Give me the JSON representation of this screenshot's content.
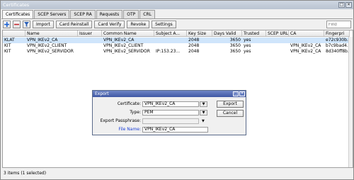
{
  "window": {
    "title": "Certificates",
    "controls": [
      "□",
      "✕"
    ]
  },
  "tabs": [
    "Certificates",
    "SCEP Servers",
    "SCEP RA",
    "Requests",
    "OTP",
    "CRL"
  ],
  "toolbar": {
    "buttons": [
      "Import",
      "Card Reinstall",
      "Card Verify",
      "Revoke",
      "Settings"
    ],
    "find_placeholder": "Find"
  },
  "table": {
    "columns": [
      "",
      "Name",
      "Issuer",
      "Common Name",
      "Subject A...",
      "Key Size",
      "Days Valid",
      "Trusted",
      "SCEP URL",
      "CA",
      "Fingerpri"
    ],
    "rows": [
      {
        "flags": "KLAT",
        "name": "VPN_IKEv2_CA",
        "issuer": "",
        "common_name": "VPN_IKEv2_CA",
        "subject_alt": "",
        "key_size": "2048",
        "days_valid": "3650",
        "trusted": "yes",
        "scep_url": "",
        "ca": "",
        "fingerprint": "e72c930b..."
      },
      {
        "flags": "KIT",
        "name": "VPN_IKEv2_CLIENT",
        "issuer": "",
        "common_name": "VPN_IKEv2_CLIENT",
        "subject_alt": "",
        "key_size": "2048",
        "days_valid": "3650",
        "trusted": "yes",
        "scep_url": "",
        "ca": "VPN_IKEv2_CA",
        "fingerprint": "b7c9bad4..."
      },
      {
        "flags": "KIT",
        "name": "VPN_IKEv2_SERVIDOR",
        "issuer": "",
        "common_name": "VPN_IKEv2_SERVIDOR",
        "subject_alt": "IP:153.23...",
        "key_size": "2048",
        "days_valid": "3650",
        "trusted": "yes",
        "scep_url": "",
        "ca": "VPN_IKEv2_CA",
        "fingerprint": "8d340ff8b..."
      }
    ]
  },
  "status": "3 items (1 selected)",
  "dialog": {
    "title": "Export",
    "controls": [
      "□",
      "✕"
    ],
    "fields": {
      "certificate_label": "Certificate:",
      "certificate_value": "VPN_IKEv2_CA",
      "type_label": "Type:",
      "type_value": "PEM",
      "passphrase_label": "Export Passphrase:",
      "passphrase_value": "",
      "filename_label": "File Name:",
      "filename_value": "VPN_IKEv2_CA"
    },
    "buttons": {
      "export": "Export",
      "cancel": "Cancel"
    }
  },
  "colors": {
    "selected_row": "#cfe5fb",
    "dialog_title": "#3f57a4",
    "label_blue": "#1b3fd6"
  }
}
